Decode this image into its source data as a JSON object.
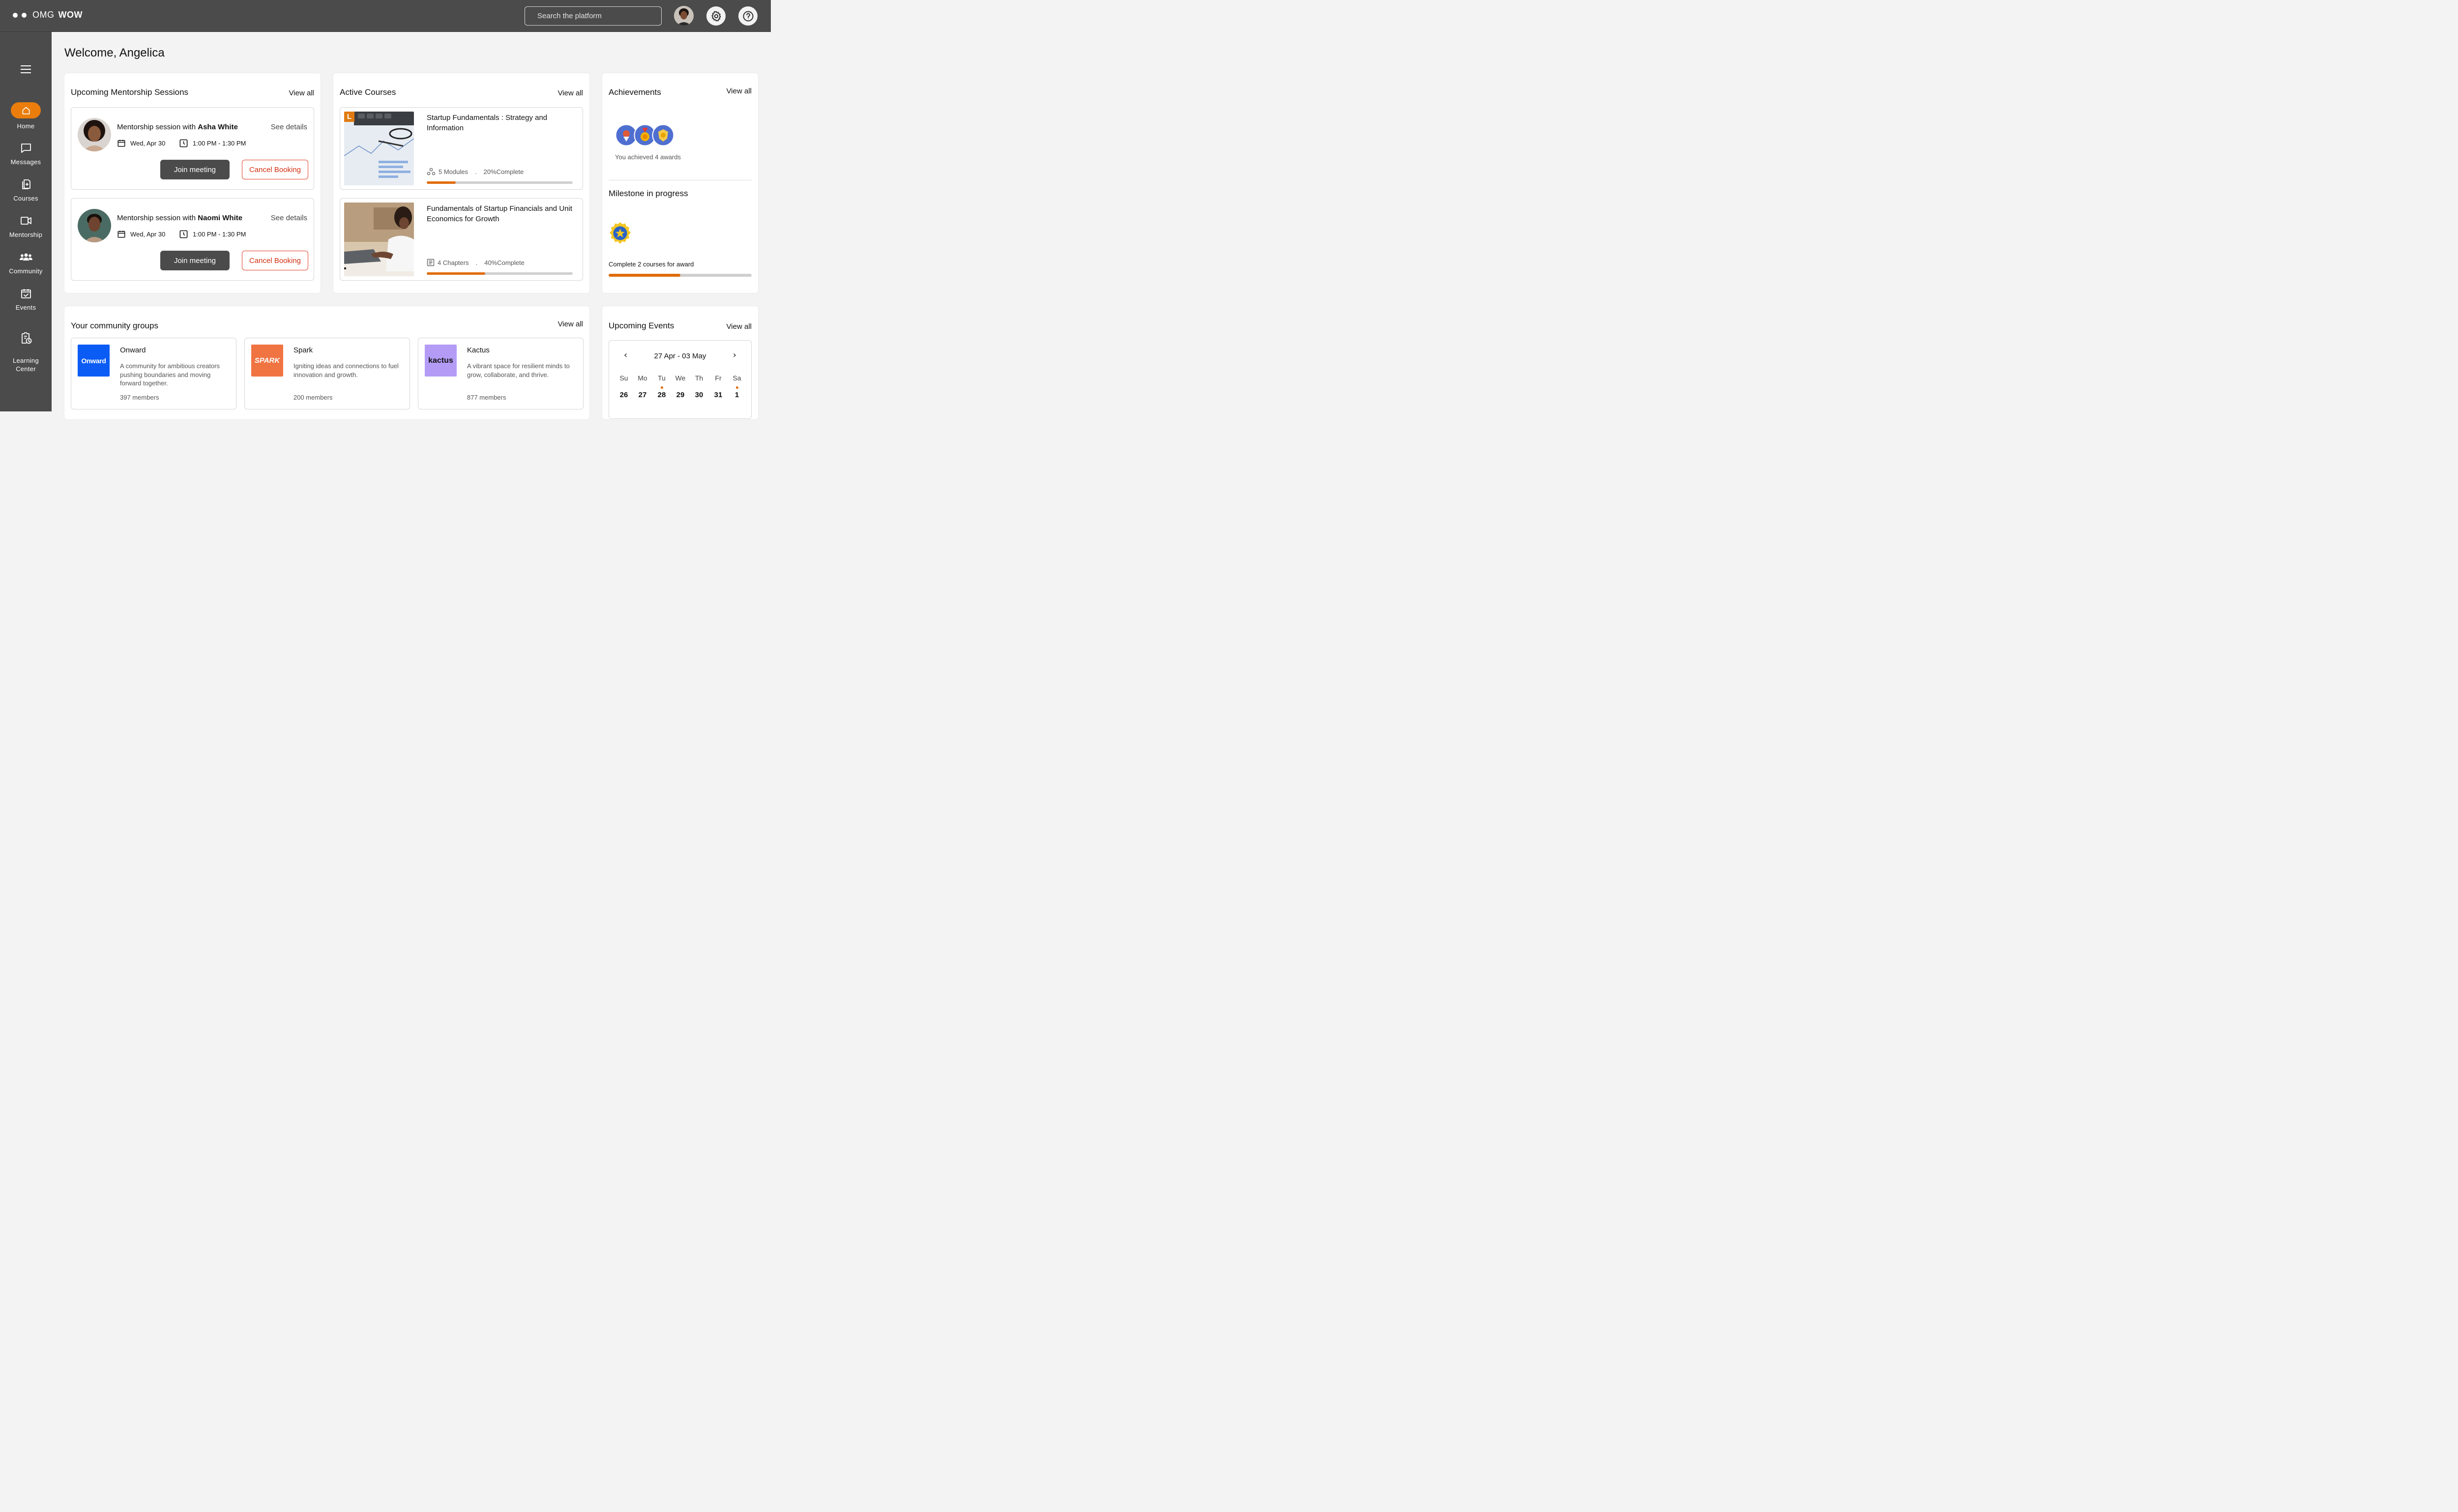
{
  "app": {
    "logo_light": "OMG",
    "logo_bold": "WOW"
  },
  "search": {
    "placeholder": "Search the platform"
  },
  "sidebar": {
    "items": [
      {
        "label": "Home",
        "icon": "home-icon",
        "active": true
      },
      {
        "label": "Messages",
        "icon": "message-icon"
      },
      {
        "label": "Courses",
        "icon": "courses-icon"
      },
      {
        "label": "Mentorship",
        "icon": "video-icon"
      },
      {
        "label": "Community",
        "icon": "community-icon"
      },
      {
        "label": "Events",
        "icon": "calendar-check-icon"
      },
      {
        "label": "Learning\nCenter",
        "icon": "learning-center-icon"
      }
    ]
  },
  "welcome": "Welcome, Angelica",
  "mentorship": {
    "title": "Upcoming Mentorship Sessions",
    "view_all": "View all",
    "sessions": [
      {
        "prefix": "Mentorship session with ",
        "mentor": "Asha White",
        "see_details": "See details",
        "date": "Wed, Apr 30",
        "time": "1:00 PM - 1:30 PM",
        "join": "Join meeting",
        "cancel": "Cancel Booking"
      },
      {
        "prefix": "Mentorship session with ",
        "mentor": "Naomi White",
        "see_details": "See details",
        "date": "Wed, Apr 30",
        "time": "1:00 PM - 1:30 PM",
        "join": "Join meeting",
        "cancel": "Cancel Booking"
      }
    ]
  },
  "courses": {
    "title": "Active Courses",
    "view_all": "View all",
    "items": [
      {
        "title": "Startup Fundamentals : Strategy and Information",
        "units": "5 Modules",
        "sep": ".",
        "complete": "20%Complete",
        "progress": 0.2,
        "badge": "L"
      },
      {
        "title": "Fundamentals of Startup Financials and Unit Economics for Growth",
        "units": "4 Chapters",
        "sep": ".",
        "complete": "40%Complete",
        "progress": 0.4
      }
    ]
  },
  "achievements": {
    "title": "Achievements",
    "view_all": "View all",
    "summary": "You achieved 4 awards",
    "milestone_title": "Milestone in progress",
    "milestone_text": "Complete 2 courses for award",
    "milestone_progress": 0.5
  },
  "community": {
    "title": "Your community groups",
    "view_all": "View all",
    "groups": [
      {
        "logo_text": "Onward",
        "name": "Onward",
        "description": "A community for ambitious creators pushing boundaries and moving forward together.",
        "members": "397 members",
        "color": "#0a5cf5"
      },
      {
        "logo_text": "SPARK",
        "name": "Spark",
        "description": "Igniting ideas and connections to fuel innovation and growth.",
        "members": "200 members",
        "color": "#f07442"
      },
      {
        "logo_text": "kactus",
        "name": "Kactus",
        "description": "A vibrant space for resilient minds to grow, collaborate, and thrive.",
        "members": "877 members",
        "color": "#b49cf6"
      }
    ]
  },
  "events": {
    "title": "Upcoming Events",
    "view_all": "View all",
    "range": "27 Apr - 03 May",
    "prev": "‹",
    "next": "›",
    "days": [
      {
        "name": "Su",
        "num": "26",
        "event": false
      },
      {
        "name": "Mo",
        "num": "27",
        "event": false
      },
      {
        "name": "Tu",
        "num": "28",
        "event": true
      },
      {
        "name": "We",
        "num": "29",
        "event": false
      },
      {
        "name": "Th",
        "num": "30",
        "event": false
      },
      {
        "name": "Fr",
        "num": "31",
        "event": false
      },
      {
        "name": "Sa",
        "num": "1",
        "event": true
      }
    ]
  },
  "colors": {
    "accent": "#ea7d0c",
    "dark": "#4b4b4b",
    "danger": "#d3300f"
  }
}
